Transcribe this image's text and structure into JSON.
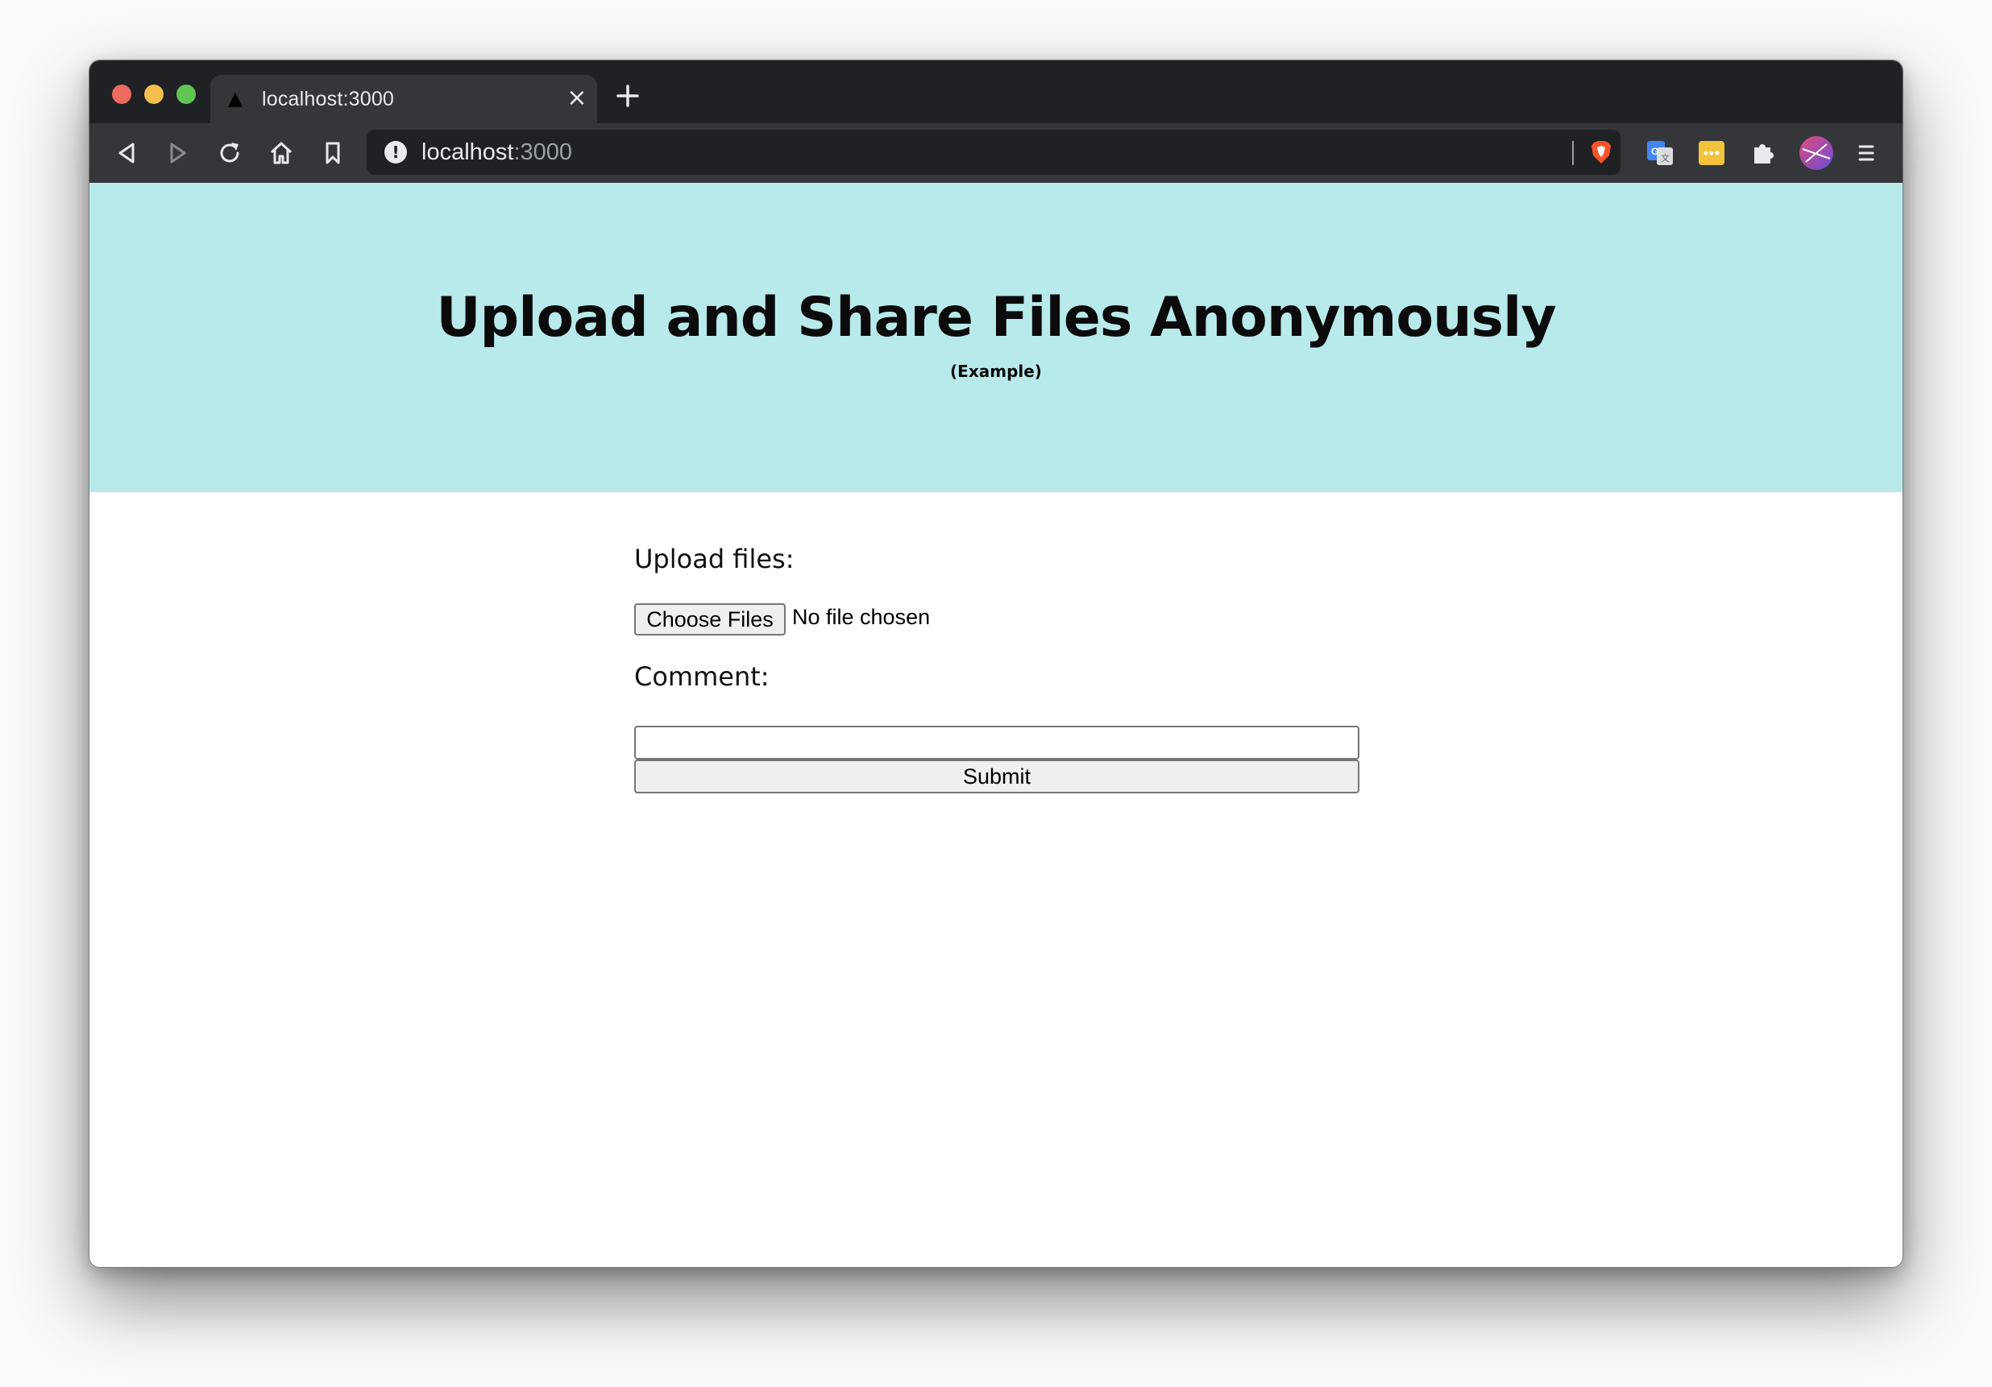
{
  "browser": {
    "tab": {
      "title": "localhost:3000",
      "close_glyph": "×",
      "favicon": "triangle-favicon-icon"
    },
    "new_tab_icon": "plus-icon",
    "toolbar": {
      "back_icon": "back-icon",
      "forward_icon": "forward-icon",
      "reload_icon": "reload-icon",
      "home_icon": "home-icon",
      "bookmark_icon": "bookmark-icon"
    },
    "omnibox": {
      "url_host": "localhost",
      "url_port": ":3000",
      "site_info_glyph": "!"
    },
    "extensions": [
      "brave-shields-icon",
      "google-translate-icon",
      "bitwarden-icon",
      "extensions-puzzle-icon",
      "profile-avatar-icon",
      "menu-icon"
    ],
    "colors": {
      "chrome_dark": "#202124",
      "toolbar": "#35363a",
      "close": "#ed6a5e",
      "minimize": "#f4bf4f",
      "maximize": "#61c554"
    }
  },
  "page": {
    "hero": {
      "title": "Upload and Share Files Anonymously",
      "subtitle": "(Example)",
      "background": "#b8eaeb"
    },
    "form": {
      "upload_label": "Upload files:",
      "choose_button": "Choose Files",
      "file_status": "No file chosen",
      "comment_label": "Comment:",
      "comment_value": "",
      "submit_label": "Submit"
    }
  }
}
